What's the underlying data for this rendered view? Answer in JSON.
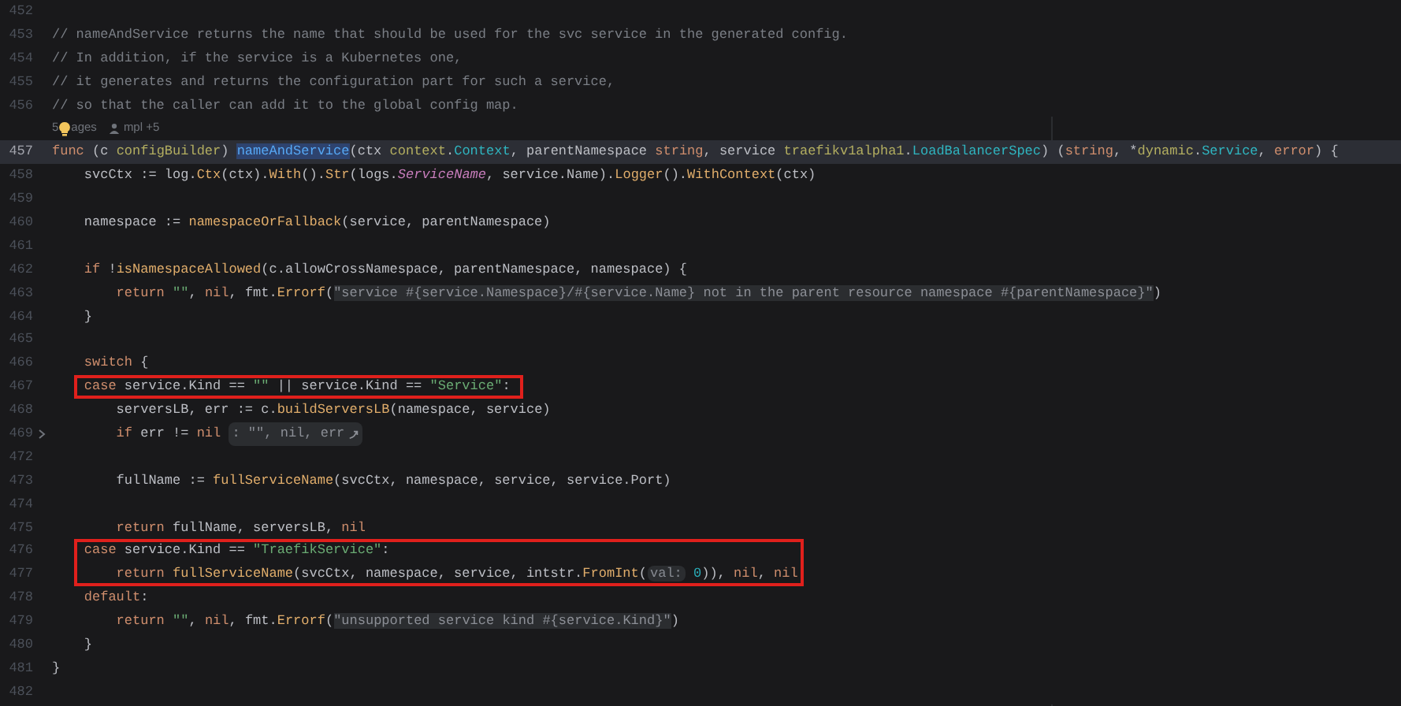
{
  "editor": {
    "groups": [
      {
        "highlighted": false,
        "lines": [
          {
            "kind": "code",
            "number": "452",
            "current": false,
            "folded": false
          },
          {
            "kind": "code",
            "number": "453",
            "current": false,
            "folded": false,
            "tokens": [
              {
                "kind": "comment",
                "text": "// nameAndService returns the name that should be used for the svc service in the generated config."
              }
            ]
          },
          {
            "kind": "code",
            "number": "454",
            "current": false,
            "folded": false,
            "tokens": [
              {
                "kind": "comment",
                "text": "// In addition, if the service is a Kubernetes one,"
              }
            ]
          },
          {
            "kind": "code",
            "number": "455",
            "current": false,
            "folded": false,
            "tokens": [
              {
                "kind": "comment",
                "text": "// it generates and returns the configuration part for such a service,"
              }
            ]
          },
          {
            "kind": "code",
            "number": "456",
            "current": false,
            "folded": false,
            "tokens": [
              {
                "kind": "comment",
                "text": "// so that the caller can add it to the global config map."
              }
            ]
          },
          {
            "kind": "inlay",
            "usages_start": "5",
            "usages_end": "ages",
            "author": "mpl +5"
          },
          {
            "kind": "code",
            "number": "457",
            "current": true,
            "folded": false,
            "tokens": [
              {
                "kind": "kw",
                "text": "func"
              },
              {
                "kind": "plain",
                "text": " (c "
              },
              {
                "kind": "pkg",
                "text": "configBuilder"
              },
              {
                "kind": "plain",
                "text": ") "
              },
              {
                "kind": "decl",
                "text": "nameAndService"
              },
              {
                "kind": "plain",
                "text": "(ctx "
              },
              {
                "kind": "pkg",
                "text": "context"
              },
              {
                "kind": "plain",
                "text": "."
              },
              {
                "kind": "type",
                "text": "Context"
              },
              {
                "kind": "plain",
                "text": ", parentNamespace "
              },
              {
                "kind": "kw",
                "text": "string"
              },
              {
                "kind": "plain",
                "text": ", service "
              },
              {
                "kind": "pkg",
                "text": "traefikv1alpha1"
              },
              {
                "kind": "plain",
                "text": "."
              },
              {
                "kind": "type",
                "text": "LoadBalancerSpec"
              },
              {
                "kind": "plain",
                "text": ") ("
              },
              {
                "kind": "kw",
                "text": "string"
              },
              {
                "kind": "plain",
                "text": ", *"
              },
              {
                "kind": "pkg",
                "text": "dynamic"
              },
              {
                "kind": "plain",
                "text": "."
              },
              {
                "kind": "type",
                "text": "Service"
              },
              {
                "kind": "plain",
                "text": ", "
              },
              {
                "kind": "kw",
                "text": "error"
              },
              {
                "kind": "plain",
                "text": ") {"
              }
            ]
          },
          {
            "kind": "code",
            "number": "458",
            "current": false,
            "folded": false,
            "tokens": [
              {
                "kind": "plain",
                "text": "    svcCtx := log."
              },
              {
                "kind": "func",
                "text": "Ctx"
              },
              {
                "kind": "plain",
                "text": "(ctx)."
              },
              {
                "kind": "func",
                "text": "With"
              },
              {
                "kind": "plain",
                "text": "()."
              },
              {
                "kind": "func",
                "text": "Str"
              },
              {
                "kind": "plain",
                "text": "(logs."
              },
              {
                "kind": "field",
                "text": "ServiceName"
              },
              {
                "kind": "plain",
                "text": ", service.Name)."
              },
              {
                "kind": "func",
                "text": "Logger"
              },
              {
                "kind": "plain",
                "text": "()."
              },
              {
                "kind": "func",
                "text": "WithContext"
              },
              {
                "kind": "plain",
                "text": "(ctx)"
              }
            ]
          },
          {
            "kind": "code",
            "number": "459",
            "current": false,
            "folded": false
          },
          {
            "kind": "code",
            "number": "460",
            "current": false,
            "folded": false,
            "tokens": [
              {
                "kind": "plain",
                "text": "    namespace := "
              },
              {
                "kind": "func",
                "text": "namespaceOrFallback"
              },
              {
                "kind": "plain",
                "text": "(service, parentNamespace)"
              }
            ]
          },
          {
            "kind": "code",
            "number": "461",
            "current": false,
            "folded": false
          },
          {
            "kind": "code",
            "number": "462",
            "current": false,
            "folded": false,
            "tokens": [
              {
                "kind": "kw",
                "text": "    if"
              },
              {
                "kind": "plain",
                "text": " !"
              },
              {
                "kind": "func",
                "text": "isNamespaceAllowed"
              },
              {
                "kind": "plain",
                "text": "(c.allowCrossNamespace, parentNamespace, namespace) {"
              }
            ]
          },
          {
            "kind": "code",
            "number": "463",
            "current": false,
            "folded": false,
            "tokens": [
              {
                "kind": "kw",
                "text": "        return"
              },
              {
                "kind": "string",
                "text": " \"\""
              },
              {
                "kind": "plain",
                "text": ", "
              },
              {
                "kind": "kw",
                "text": "nil"
              },
              {
                "kind": "plain",
                "text": ", fmt."
              },
              {
                "kind": "func",
                "text": "Errorf"
              },
              {
                "kind": "plain",
                "text": "("
              },
              {
                "kind": "format",
                "text": "\"service #{service.Namespace}/#{service.Name} not in the parent resource namespace #{parentNamespace}\""
              },
              {
                "kind": "plain",
                "text": ")"
              }
            ]
          },
          {
            "kind": "code",
            "number": "464",
            "current": false,
            "folded": false,
            "tokens": [
              {
                "kind": "plain",
                "text": "    }"
              }
            ]
          },
          {
            "kind": "code",
            "number": "465",
            "current": false,
            "folded": false
          },
          {
            "kind": "code",
            "number": "466",
            "current": false,
            "folded": false,
            "tokens": [
              {
                "kind": "kw",
                "text": "    switch"
              },
              {
                "kind": "plain",
                "text": " {"
              }
            ]
          }
        ]
      },
      {
        "highlighted": true,
        "lines": [
          {
            "kind": "code",
            "number": "467",
            "current": false,
            "folded": false,
            "tokens": [
              {
                "kind": "kw",
                "text": "    case"
              },
              {
                "kind": "plain",
                "text": " service.Kind == "
              },
              {
                "kind": "string",
                "text": "\"\""
              },
              {
                "kind": "plain",
                "text": " || service.Kind == "
              },
              {
                "kind": "string",
                "text": "\"Service\""
              },
              {
                "kind": "plain",
                "text": ":"
              }
            ]
          }
        ]
      },
      {
        "highlighted": false,
        "lines": [
          {
            "kind": "code",
            "number": "468",
            "current": false,
            "folded": false,
            "tokens": [
              {
                "kind": "plain",
                "text": "        serversLB, err := c."
              },
              {
                "kind": "func",
                "text": "buildServersLB"
              },
              {
                "kind": "plain",
                "text": "(namespace, service)"
              }
            ]
          },
          {
            "kind": "code",
            "number": "469",
            "current": false,
            "folded": true,
            "tokens": [
              {
                "kind": "kw",
                "text": "        if"
              },
              {
                "kind": "plain",
                "text": " err != "
              },
              {
                "kind": "kw",
                "text": "nil "
              },
              {
                "kind": "fold",
                "text": ": \"\", nil, err"
              }
            ]
          },
          {
            "kind": "code",
            "number": "472",
            "current": false,
            "folded": false
          },
          {
            "kind": "code",
            "number": "473",
            "current": false,
            "folded": false,
            "tokens": [
              {
                "kind": "plain",
                "text": "        fullName := "
              },
              {
                "kind": "func",
                "text": "fullServiceName"
              },
              {
                "kind": "plain",
                "text": "(svcCtx, namespace, service, service.Port)"
              }
            ]
          },
          {
            "kind": "code",
            "number": "474",
            "current": false,
            "folded": false
          },
          {
            "kind": "code",
            "number": "475",
            "current": false,
            "folded": false,
            "tokens": [
              {
                "kind": "kw",
                "text": "        return"
              },
              {
                "kind": "plain",
                "text": " fullName, serversLB, "
              },
              {
                "kind": "kw",
                "text": "nil"
              }
            ]
          }
        ]
      },
      {
        "highlighted": true,
        "lines": [
          {
            "kind": "code",
            "number": "476",
            "current": false,
            "folded": false,
            "tokens": [
              {
                "kind": "kw",
                "text": "    case"
              },
              {
                "kind": "plain",
                "text": " service.Kind == "
              },
              {
                "kind": "string",
                "text": "\"TraefikService\""
              },
              {
                "kind": "plain",
                "text": ":"
              }
            ]
          },
          {
            "kind": "code",
            "number": "477",
            "current": false,
            "folded": false,
            "tokens": [
              {
                "kind": "kw",
                "text": "        return "
              },
              {
                "kind": "func",
                "text": "fullServiceName"
              },
              {
                "kind": "plain",
                "text": "(svcCtx, namespace, service, intstr."
              },
              {
                "kind": "func",
                "text": "FromInt"
              },
              {
                "kind": "plain",
                "text": "("
              },
              {
                "kind": "hint",
                "text": "val:"
              },
              {
                "kind": "number",
                "text": " 0"
              },
              {
                "kind": "plain",
                "text": ")), "
              },
              {
                "kind": "kw",
                "text": "nil"
              },
              {
                "kind": "plain",
                "text": ", "
              },
              {
                "kind": "kw",
                "text": "nil"
              }
            ]
          }
        ]
      },
      {
        "highlighted": false,
        "lines": [
          {
            "kind": "code",
            "number": "478",
            "current": false,
            "folded": false,
            "tokens": [
              {
                "kind": "kw",
                "text": "    default"
              },
              {
                "kind": "plain",
                "text": ":"
              }
            ]
          },
          {
            "kind": "code",
            "number": "479",
            "current": false,
            "folded": false,
            "tokens": [
              {
                "kind": "kw",
                "text": "        return"
              },
              {
                "kind": "string",
                "text": " \"\""
              },
              {
                "kind": "plain",
                "text": ", "
              },
              {
                "kind": "kw",
                "text": "nil"
              },
              {
                "kind": "plain",
                "text": ", fmt."
              },
              {
                "kind": "func",
                "text": "Errorf"
              },
              {
                "kind": "plain",
                "text": "("
              },
              {
                "kind": "format",
                "text": "\"unsupported service kind #{service.Kind}\""
              },
              {
                "kind": "plain",
                "text": ")"
              }
            ]
          },
          {
            "kind": "code",
            "number": "480",
            "current": false,
            "folded": false,
            "tokens": [
              {
                "kind": "plain",
                "text": "    }"
              }
            ]
          },
          {
            "kind": "code",
            "number": "481",
            "current": false,
            "folded": false,
            "tokens": [
              {
                "kind": "plain",
                "text": "}"
              }
            ]
          },
          {
            "kind": "code",
            "number": "482",
            "current": false,
            "folded": false
          }
        ]
      }
    ]
  }
}
